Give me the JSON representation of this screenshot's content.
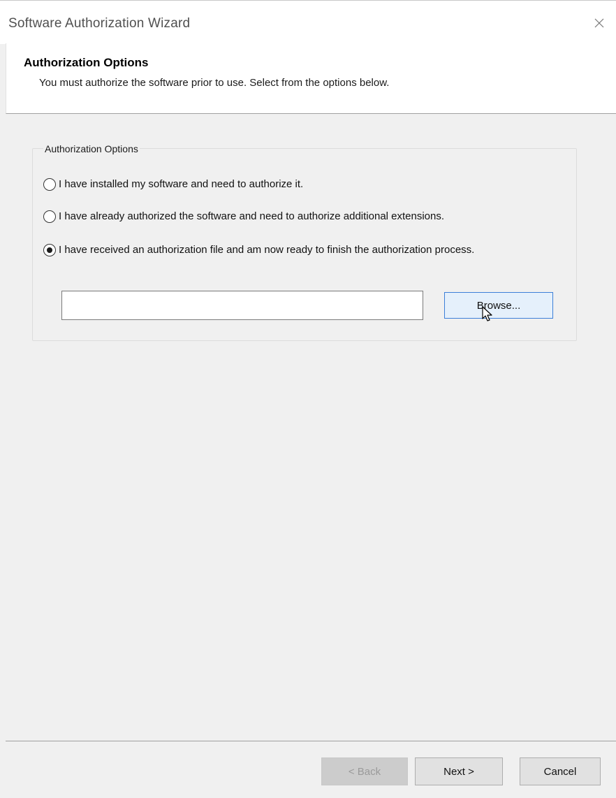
{
  "window": {
    "title": "Software Authorization Wizard"
  },
  "header": {
    "title": "Authorization Options",
    "subtitle": "You must authorize the software prior to use. Select from the options below."
  },
  "options_group": {
    "legend": "Authorization Options",
    "options": [
      {
        "label": "I have installed my software and need to authorize it.",
        "selected": false
      },
      {
        "label": "I have already authorized the software and need to authorize additional extensions.",
        "selected": false
      },
      {
        "label": "I have received an authorization file and am now ready to finish the authorization process.",
        "selected": true
      }
    ],
    "file_path": {
      "value": "",
      "placeholder": ""
    },
    "browse_label": "Browse..."
  },
  "footer": {
    "back_label": "< Back",
    "back_enabled": false,
    "next_label": "Next >",
    "cancel_label": "Cancel"
  },
  "icons": {
    "close": "close-icon",
    "cursor": "mouse-pointer-icon"
  },
  "colors": {
    "accent_border": "#3c7fd8",
    "button_hover_bg": "#e5f0fb",
    "dialog_bg": "#f0f0f0"
  }
}
